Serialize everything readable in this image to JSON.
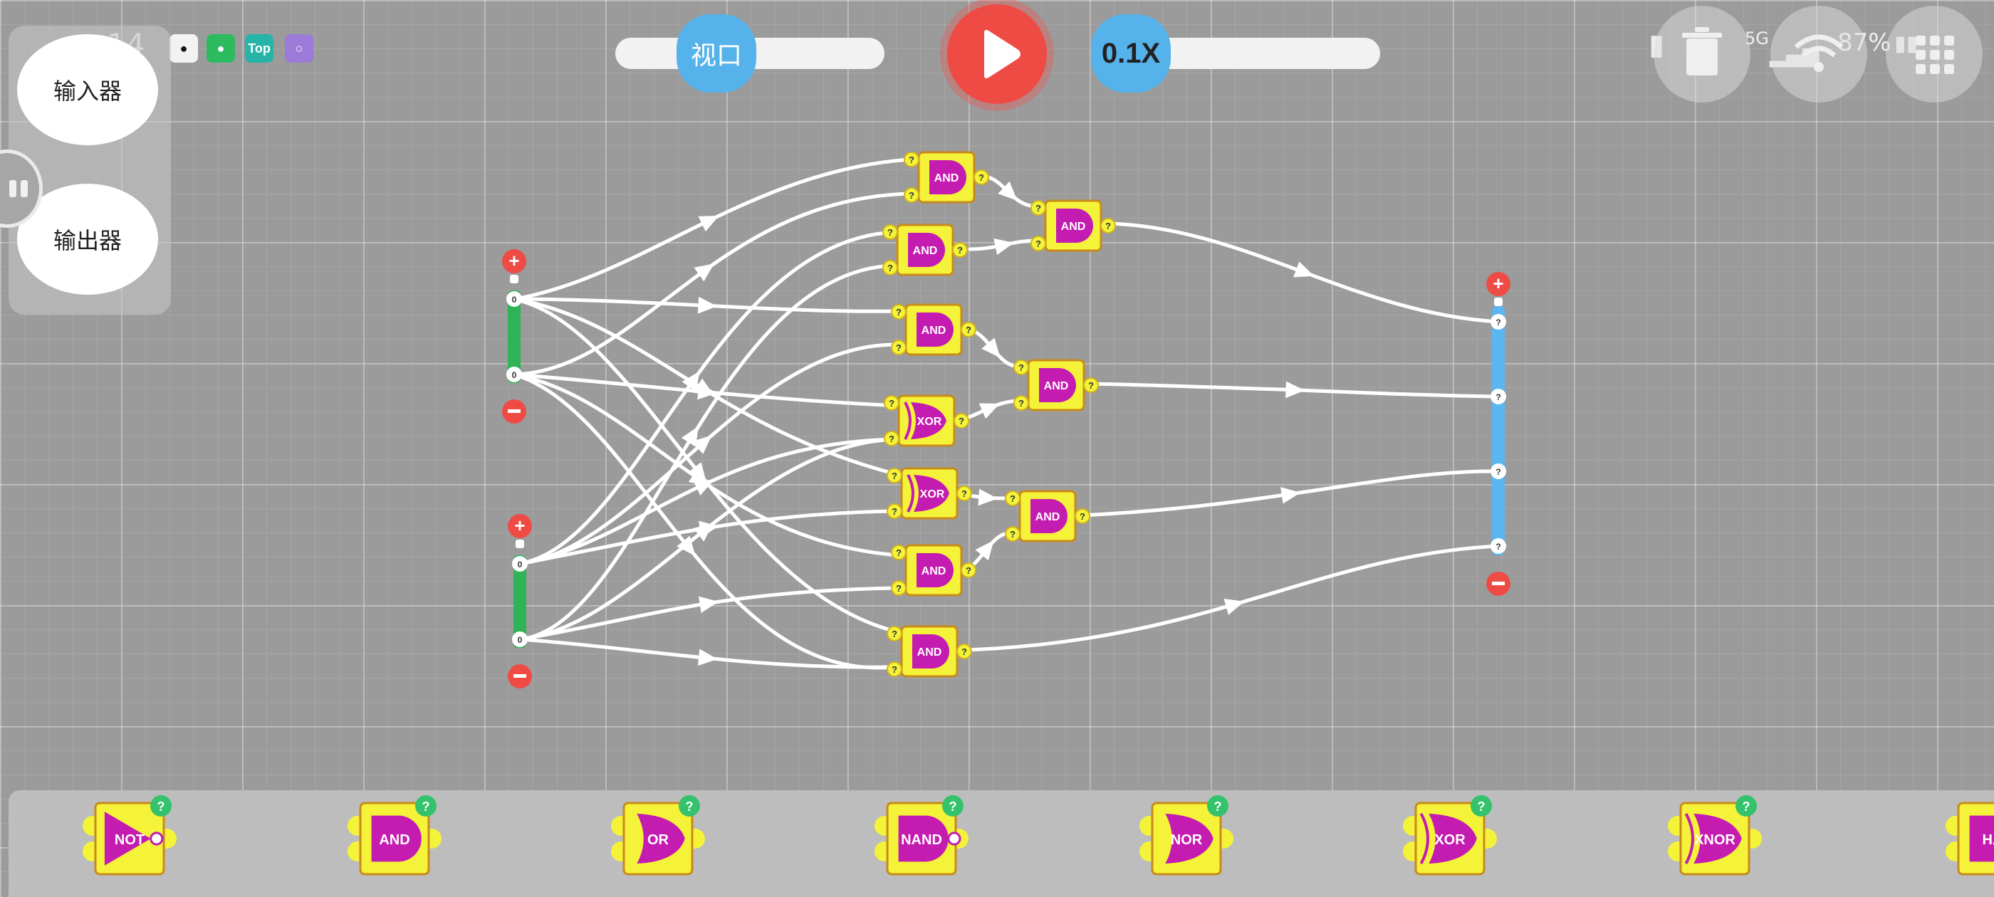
{
  "status_bar": {
    "time": "14",
    "network": "5G",
    "battery": "87%",
    "apps": [
      {
        "name": "qq-icon",
        "label": "",
        "color": "#f2f2f2"
      },
      {
        "name": "wechat-icon",
        "label": "",
        "color": "#2dbb5f"
      },
      {
        "name": "top-icon",
        "label": "Top",
        "color": "#26b3a8"
      },
      {
        "name": "app-icon",
        "label": "",
        "color": "#9c7ad8"
      }
    ]
  },
  "toolbar": {
    "viewport_label": "视口",
    "speed_label": "0.1X"
  },
  "side_panel": {
    "input_label": "输入器",
    "output_label": "输出器"
  },
  "gates": [
    {
      "id": "g1",
      "type": "AND"
    },
    {
      "id": "g2",
      "type": "AND"
    },
    {
      "id": "g3",
      "type": "AND"
    },
    {
      "id": "g4",
      "type": "AND"
    },
    {
      "id": "g5",
      "type": "XOR"
    },
    {
      "id": "g6",
      "type": "XOR"
    },
    {
      "id": "g7",
      "type": "AND"
    },
    {
      "id": "g8",
      "type": "AND"
    },
    {
      "id": "g9",
      "type": "AND"
    },
    {
      "id": "g10",
      "type": "AND"
    },
    {
      "id": "g11",
      "type": "AND"
    }
  ],
  "pin_label": "?",
  "pin_value": "0",
  "palette": [
    "NOT",
    "AND",
    "OR",
    "NAND",
    "NOR",
    "XOR",
    "XNOR",
    "HA"
  ],
  "colors": {
    "gate": "#f4f33a",
    "gate_body": "#c41bb0",
    "input_bar": "#2fb357",
    "output_bar": "#5ab6f0",
    "danger": "#ef4b45",
    "add": "#ef4b45",
    "help": "#35c26c"
  }
}
